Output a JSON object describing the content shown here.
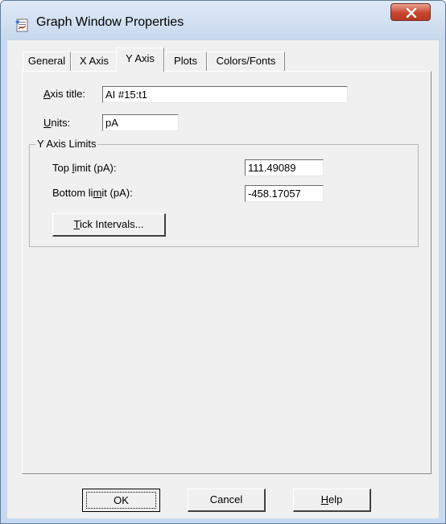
{
  "window": {
    "title": "Graph Window Properties",
    "icon": "graph-properties-icon",
    "close_icon": "close-icon"
  },
  "tabs": [
    {
      "label": "General",
      "active": false
    },
    {
      "label": "X Axis",
      "active": false
    },
    {
      "label": "Y Axis",
      "active": true
    },
    {
      "label": "Plots",
      "active": false
    },
    {
      "label": "Colors/Fonts",
      "active": false
    }
  ],
  "y_axis": {
    "axis_title_label": "Axis title:",
    "axis_title_value": "AI #15:t1",
    "units_label": "Units:",
    "units_value": "pA",
    "limits_group_title": "Y Axis Limits",
    "top_limit_label": "Top limit (pA):",
    "top_limit_value": "111.49089",
    "bottom_limit_label": "Bottom limit (pA):",
    "bottom_limit_value": "-458.17057",
    "tick_intervals_button": "Tick Intervals..."
  },
  "footer": {
    "ok_label": "OK",
    "cancel_label": "Cancel",
    "help_label": "Help"
  },
  "colors": {
    "titlebar": "#c6d8ee",
    "close_button": "#c8452f",
    "dialog_face": "#f0f0f0"
  }
}
